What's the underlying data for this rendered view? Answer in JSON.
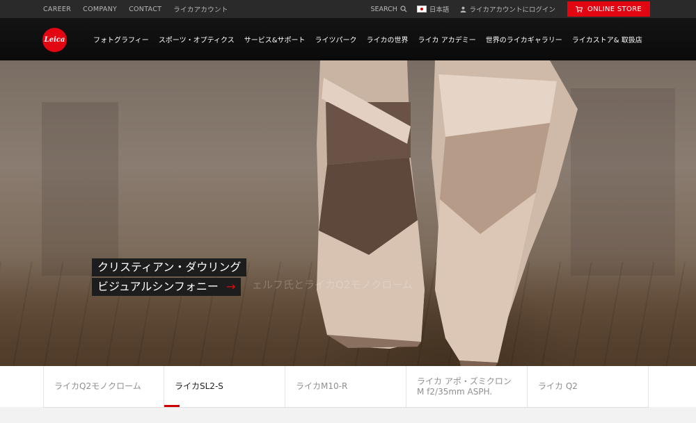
{
  "topbar": {
    "links": [
      "CAREER",
      "COMPANY",
      "CONTACT",
      "ライカアカウント"
    ],
    "search_label": "SEARCH",
    "language_label": "日本語",
    "account_label": "ライカアカウントにログイン",
    "store_label": "ONLINE STORE"
  },
  "nav": {
    "logo_text": "Leica",
    "items": [
      "フォトグラフィー",
      "スポーツ・オプティクス",
      "サービス&サポート",
      "ライツパーク",
      "ライカの世界",
      "ライカ アカデミー",
      "世界のライカギャラリー",
      "ライカストア& 取扱店"
    ]
  },
  "hero": {
    "caption_line1": "クリスティアン・ダウリング",
    "caption_line2": "ビジュアルシンフォニー",
    "caption_arrow": "→",
    "ghost_text": "ェルフ氏とライカQ2モノクローム"
  },
  "tabs": [
    {
      "label": "ライカQ2モノクローム",
      "active": false
    },
    {
      "label": "ライカSL2-S",
      "active": true
    },
    {
      "label": "ライカM10-R",
      "active": false
    },
    {
      "label": "ライカ アポ・ズミクロンM f2/35mm ASPH.",
      "active": false
    },
    {
      "label": "ライカ Q2",
      "active": false
    }
  ],
  "colors": {
    "brand_red": "#e20613",
    "topbar_bg": "#2a2a2a",
    "nav_bg": "#0e0e0e"
  }
}
